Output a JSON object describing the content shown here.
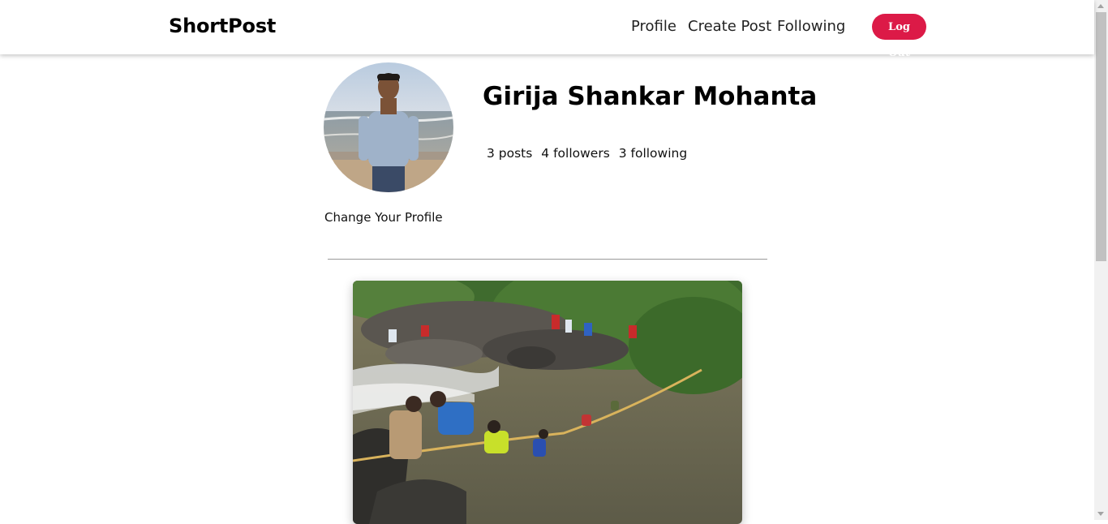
{
  "nav": {
    "brand": "ShortPost",
    "links": [
      "Profile",
      "Create Post",
      "Following"
    ],
    "logout_label": "Log Out"
  },
  "profile": {
    "name": "Girija Shankar Mohanta",
    "stats": {
      "posts": "3 posts",
      "followers": "4 followers",
      "following": "3 following"
    },
    "change_label": "Change Your Profile"
  },
  "colors": {
    "accent": "#dc1a47",
    "background": "#ffffff"
  }
}
